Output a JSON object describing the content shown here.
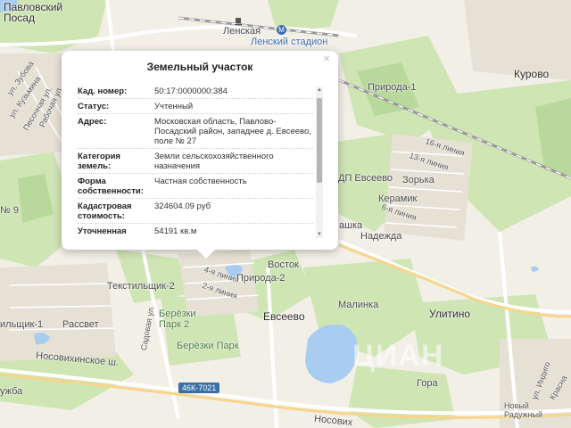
{
  "map": {
    "places": {
      "pavlovsky_posad": "Павловский\nПосад",
      "lenskaya": "Ленская",
      "lensky_stadion": "Ленский стадион",
      "kurovo": "Курово",
      "priroda1": "Природа-1",
      "liniya16": "16-я линия",
      "liniya13": "13-я линия",
      "dp_evseevo": "ДП Евсеево",
      "zorka": "Зорька",
      "keramik": "Керамик",
      "liniya6": "6-я линия",
      "nadezhda": "Надежда",
      "ashka": "ашка",
      "no9": "№ 9",
      "ul_zubova": "ул. Зубова",
      "ul_kuzmina": "ул. Кузьмина",
      "pesochnaya": "Песочная ул.",
      "rabochaya": "Рабочая ул.",
      "vostok": "Восток",
      "liniya4": "4-я линия",
      "liniya2": "2-я линия",
      "priroda2": "Природа-2",
      "tekstilshik2": "Текстильщик-2",
      "tekstilshik1": "ильщик-1",
      "rassvet": "Рассвет",
      "sadovaya": "Садовая ул.",
      "berezki2": "Берёзки\nПарк 2",
      "berezki": "Берёзки Парк",
      "evseevo": "Евсеево",
      "malinka": "Малинка",
      "ulitino": "Улитино",
      "nosovikhinskoe": "Носовихинское ш.",
      "nosovikh2": "Носових",
      "gora": "Гора",
      "novy_raduzhny": "Новый\nРадужный",
      "ul_indiro": "ул. Индиго",
      "krasn": "Красна",
      "uzhba": "ужба",
      "route": "46К-7021",
      "metro_m": "M",
      "watermark": "ЦИАН"
    }
  },
  "popup": {
    "title": "Земельный участок",
    "close": "×",
    "rows": [
      {
        "key": "Кад. номер:",
        "value": "50:17:0000000:384"
      },
      {
        "key": "Статус:",
        "value": "Учтенный"
      },
      {
        "key": "Адрес:",
        "value": "Московская область, Павлово-Посадский район, западнее д. Евсеево, поле № 27"
      },
      {
        "key": "Категория земель:",
        "value": "Земли сельскохозяйственного назначения"
      },
      {
        "key": "Форма собственности:",
        "value": "Частная собственность"
      },
      {
        "key": "Кадастровая стоимость:",
        "value": "324604.09 руб"
      },
      {
        "key": "Уточненная площадь:",
        "value": "54191 кв.м"
      }
    ],
    "scroll_up": "▲",
    "scroll_down": "▼"
  }
}
